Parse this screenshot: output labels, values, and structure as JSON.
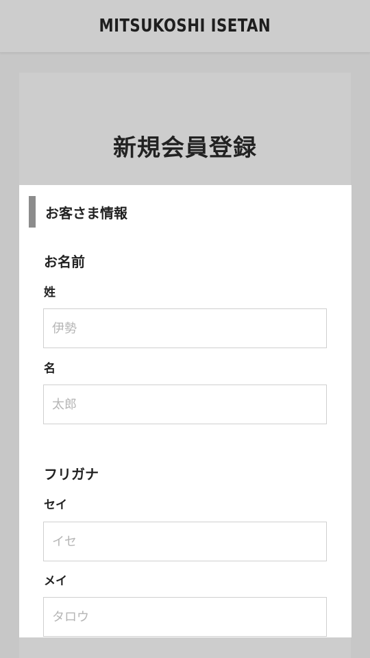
{
  "header": {
    "logo_text": "MITSUKOSHI ISETAN"
  },
  "page": {
    "title": "新規会員登録"
  },
  "section": {
    "heading": "お客さま情報"
  },
  "name_group": {
    "label": "お名前",
    "last_name": {
      "label": "姓",
      "value": "",
      "placeholder": "伊勢"
    },
    "first_name": {
      "label": "名",
      "value": "",
      "placeholder": "太郎"
    }
  },
  "kana_group": {
    "label": "フリガナ",
    "last_name": {
      "label": "セイ",
      "value": "",
      "placeholder": "イセ"
    },
    "first_name": {
      "label": "メイ",
      "value": "",
      "placeholder": "タロウ"
    }
  },
  "colors": {
    "background": "#c7c7c7",
    "header": "#cdcdcd",
    "panel": "#ffffff",
    "section_bar": "#8c8c8c",
    "input_border": "#cfcfcf",
    "placeholder": "#b5b5b5"
  }
}
